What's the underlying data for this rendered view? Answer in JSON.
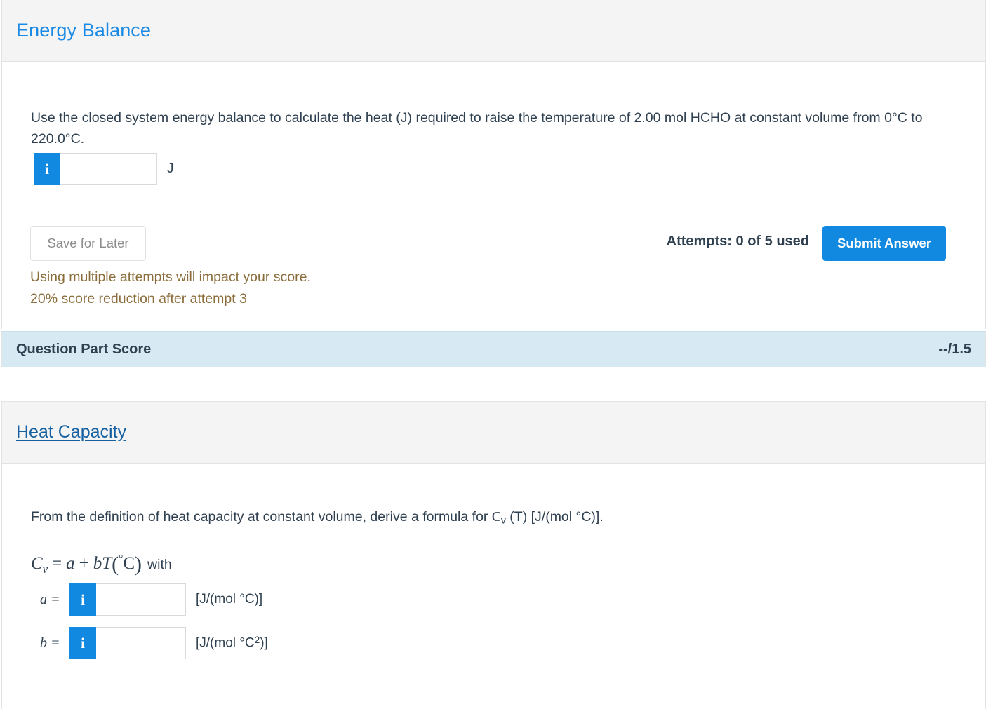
{
  "sections": [
    {
      "id": "energy-balance",
      "title": "Energy Balance",
      "question": "Use the closed system energy balance to calculate the heat (J) required to raise the temperature of 2.00 mol HCHO at constant volume from 0°C to 220.0°C.",
      "answer": {
        "info_icon": "info-icon",
        "value": "",
        "placeholder": "",
        "unit": "J"
      },
      "actions": {
        "save_label": "Save for Later",
        "submit_label": "Submit Answer",
        "attempts_text": "Attempts: 0 of 5 used"
      },
      "warnings": [
        "Using multiple attempts will impact your score.",
        "20% score reduction after attempt 3"
      ],
      "score_bar": {
        "label": "Question Part Score",
        "value": "--/1.5"
      }
    },
    {
      "id": "heat-capacity",
      "title": "Heat Capacity",
      "question_parts": {
        "lead": "From the definition of heat capacity at constant volume, derive a formula for ",
        "symbol": "C",
        "symbol_sub": "v",
        "mid": " (T) [J/(mol °C)].",
        "full": "From the definition of heat capacity at constant volume, derive a formula for Cv (T) [J/(mol °C)]."
      },
      "formula": {
        "lhs": "C",
        "lhs_sub": "v",
        "equals": "=",
        "term_a": "a",
        "plus": "+",
        "term_b": "b",
        "term_T": "T",
        "degree": "°",
        "celsius": "C",
        "trailing": "with"
      },
      "fields": [
        {
          "label": "a =",
          "info_icon": "info-icon",
          "value": "",
          "placeholder": "",
          "unit": "[J/(mol °C)]",
          "unit_base": "[J/(mol °C)]",
          "unit_exp": ""
        },
        {
          "label": "b =",
          "info_icon": "info-icon",
          "value": "",
          "placeholder": "",
          "unit": "[J/(mol °C2)]",
          "unit_base": "[J/(mol °C",
          "unit_exp": "2",
          "unit_tail": ")]"
        }
      ]
    }
  ],
  "colors": {
    "header_title_blue": "#1b8ae5",
    "link_blue": "#1560a0",
    "accent_blue": "#1189e0",
    "warning_brown": "#8a6d3b",
    "score_bar_bg": "#d7eaf3",
    "header_band_bg": "#f4f4f4",
    "text": "#2f4050"
  }
}
